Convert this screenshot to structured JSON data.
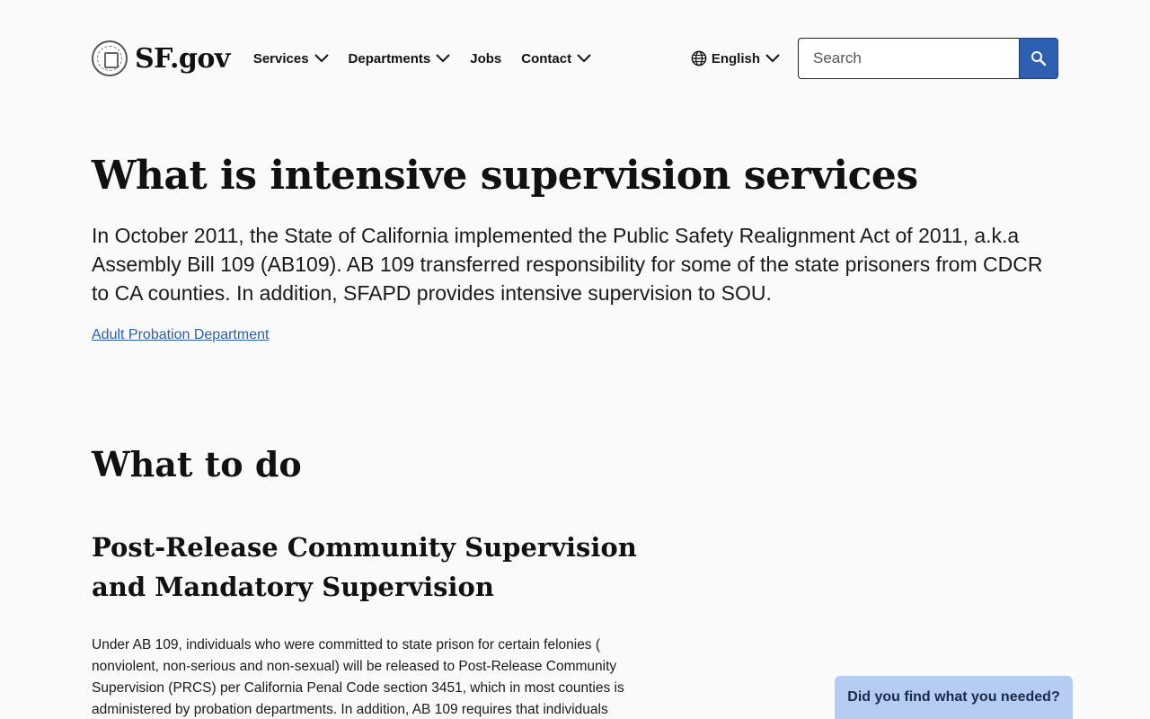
{
  "header": {
    "logo_text": "SF.gov",
    "nav": [
      {
        "label": "Services",
        "has_dropdown": true
      },
      {
        "label": "Departments",
        "has_dropdown": true
      },
      {
        "label": "Jobs",
        "has_dropdown": false
      },
      {
        "label": "Contact",
        "has_dropdown": true
      }
    ],
    "language": "English",
    "search_placeholder": "Search"
  },
  "main": {
    "title": "What is intensive supervision services",
    "intro": "In October 2011, the State of California implemented the Public Safety Realignment Act of 2011, a.k.a Assembly Bill 109 (AB109). AB 109 transferred responsibility for some of the state prisoners from CDCR to CA counties. In addition, SFAPD provides intensive supervision to SOU.",
    "department_link": "Adult Probation Department",
    "section_heading": "What to do",
    "subsection_heading": "Post-Release Community Supervision and Mandatory Supervision",
    "subsection_body": "Under AB 109, individuals who were committed to state prison for certain felonies ( nonviolent, non-serious and non-sexual) will be released to Post-Release Community Supervision (PRCS) per California Penal Code section 3451, which in most counties is administered by probation departments. In addition, AB 109 requires that individuals"
  },
  "feedback": {
    "label": "Did you find what you needed?"
  },
  "colors": {
    "accent": "#2f5fb0",
    "link": "#2d5fa6",
    "feedback_bg": "#b5cdf3",
    "background": "#fafafa"
  }
}
